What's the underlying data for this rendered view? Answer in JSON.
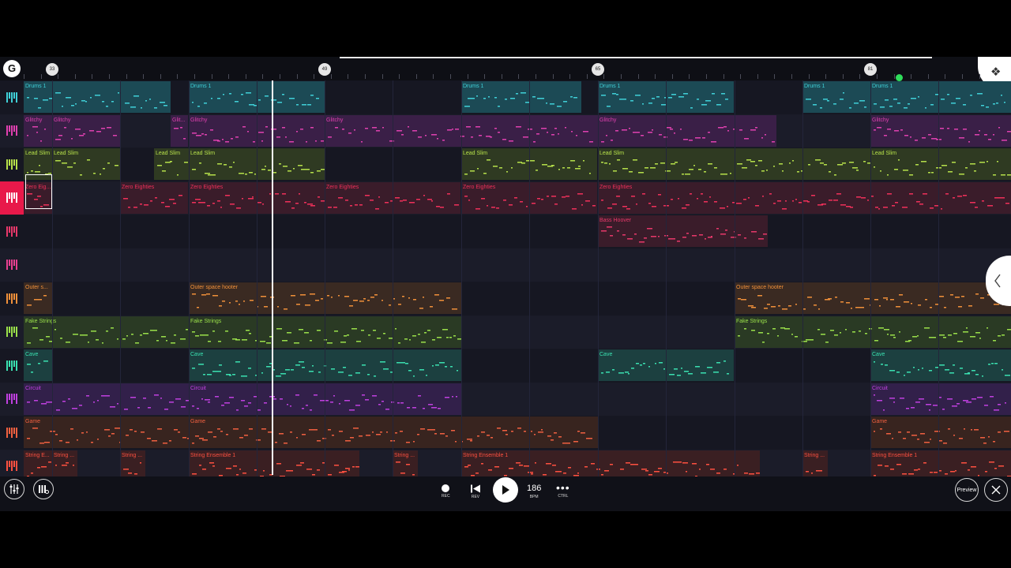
{
  "ruler": {
    "markers": [
      "33",
      "49",
      "65",
      "81"
    ]
  },
  "tracks": [
    {
      "color": "#3fd0d8",
      "clip_bg": "#1c4a55",
      "clips": [
        {
          "label": "Drums 1"
        },
        {
          "label": "Drums 1"
        },
        {
          "label": "Drums 1"
        },
        {
          "label": "Drums 1"
        },
        {
          "label": "Drums 1"
        },
        {
          "label": "Drums 1"
        }
      ]
    },
    {
      "color": "#e040b0",
      "clip_bg": "#3a1f47",
      "clips": [
        {
          "label": "Glitchy"
        },
        {
          "label": "Glitchy"
        },
        {
          "label": "Glit..."
        },
        {
          "label": "Glitchy"
        },
        {
          "label": "Glitchy"
        },
        {
          "label": "Glitchy"
        },
        {
          "label": "Glitchy"
        }
      ]
    },
    {
      "color": "#b6e04a",
      "clip_bg": "#2f3a22",
      "clips": [
        {
          "label": "Lead Slim"
        },
        {
          "label": "Lead Slim"
        },
        {
          "label": "Lead Slim"
        },
        {
          "label": "Lead Slim"
        },
        {
          "label": "Lead Slim"
        },
        {
          "label": "Lead Slim"
        },
        {
          "label": "Lead Slim"
        }
      ]
    },
    {
      "color": "#f0305a",
      "clip_bg": "#3a1c2a",
      "clips": [
        {
          "label": "Zero Eig..."
        },
        {
          "label": "Zero Eighties"
        },
        {
          "label": "Zero Eighties"
        },
        {
          "label": "Zero Eighties"
        },
        {
          "label": "Zero Eighties"
        },
        {
          "label": "Zero Eighties"
        }
      ]
    },
    {
      "color": "#e8386a",
      "clip_bg": "#3a1c2a",
      "clips": [
        {
          "label": "Bass Hoover"
        }
      ]
    },
    {
      "color": "#e84090",
      "clip_bg": "#3a1c2a",
      "clips": []
    },
    {
      "color": "#f0903a",
      "clip_bg": "#3a2a22",
      "clips": [
        {
          "label": "Outer s..."
        },
        {
          "label": "Outer space hooter"
        },
        {
          "label": "Outer space hooter"
        }
      ]
    },
    {
      "color": "#9ae04a",
      "clip_bg": "#2a3a24",
      "clips": [
        {
          "label": "Fake Strings"
        },
        {
          "label": "Fake Strings"
        },
        {
          "label": "Fake Strings"
        }
      ]
    },
    {
      "color": "#3ae0b0",
      "clip_bg": "#1c4040",
      "clips": [
        {
          "label": "Cave"
        },
        {
          "label": "Cave"
        },
        {
          "label": "Cave"
        },
        {
          "label": "Cave"
        }
      ]
    },
    {
      "color": "#c040e0",
      "clip_bg": "#32204a",
      "clips": [
        {
          "label": "Circuit"
        },
        {
          "label": "Circuit"
        },
        {
          "label": "Circuit"
        }
      ]
    },
    {
      "color": "#f06040",
      "clip_bg": "#38241f",
      "clips": [
        {
          "label": "Game"
        },
        {
          "label": "Game"
        },
        {
          "label": "Game"
        }
      ]
    },
    {
      "color": "#ff5040",
      "clip_bg": "#3a1f22",
      "clips": [
        {
          "label": "String E..."
        },
        {
          "label": "String ..."
        },
        {
          "label": "String ..."
        },
        {
          "label": "String Ensemble 1"
        },
        {
          "label": "String ..."
        },
        {
          "label": "String Ensemble 1"
        },
        {
          "label": "String ..."
        },
        {
          "label": "String Ensemble 1"
        }
      ]
    }
  ],
  "transport": {
    "rec_label": "REC",
    "rev_label": "REV",
    "bpm_value": "186",
    "bpm_label": "BPM",
    "ctrl_label": "CTRL"
  },
  "preview_label": "Preview"
}
